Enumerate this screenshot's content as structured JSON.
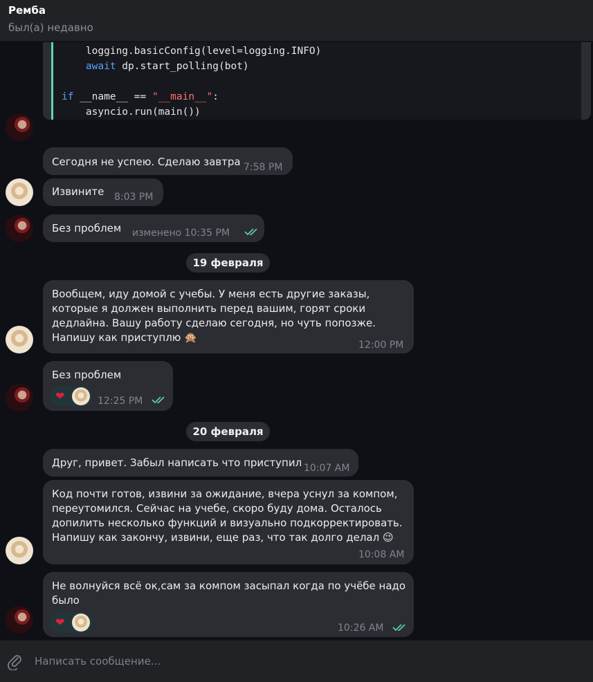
{
  "header": {
    "title": "Ремба",
    "status": "был(а) недавно"
  },
  "code": {
    "line1_a": "logging",
    "line1_b": ".basicConfig(level=logging.INFO)",
    "line2_kw": "await",
    "line2_b": " dp.start_polling(bot)",
    "line3_kw": "if",
    "line3_b": " __name__ == ",
    "line3_str": "\"__main__\"",
    "line3_c": ":",
    "line4": "asyncio.run(main())"
  },
  "messages": [
    {
      "text": "Сегодня не успею. Сделаю завтра",
      "time": "7:58 PM"
    },
    {
      "text": "Извините",
      "time": "8:03 PM"
    },
    {
      "text": "Без проблем",
      "time": "изменено 10:35 PM"
    },
    {
      "text": "Вообщем, иду домой с учебы. У меня есть другие заказы,\nкоторые я должен выполнить перед вашим, горят сроки\nдедлайна. Вашу работу сделаю сегодня, но чуть попозже.\nНапишу как приступлю 🙊",
      "time": "12:00 PM"
    },
    {
      "text": "Без проблем",
      "time": "12:25 PM"
    },
    {
      "text": "Друг, привет. Забыл написать что приступил",
      "time": "10:07 AM"
    },
    {
      "text": "Код почти готов, извини за ожидание, вчера уснул за компом,\nпереутомился. Сейчас на учебе, скоро буду дома. Осталось\nдопилить несколько функций и визуально подкорректировать.\nНапишу как закончу, извини, еще раз, что так долго делал 😉",
      "time": "10:08 AM"
    },
    {
      "text": "Не волнуйся всё ок,сам за компом засыпал когда по учёбе надо\nбыло",
      "time": "10:26 AM"
    }
  ],
  "dates": {
    "d1": "19 февраля",
    "d2": "20 февраля"
  },
  "reactions": {
    "heart": "❤"
  },
  "composer": {
    "placeholder": "Написать сообщение..."
  },
  "colors": {
    "accent": "#64d2b3",
    "bubble": "#2b2d33",
    "background": "#0e1015"
  }
}
